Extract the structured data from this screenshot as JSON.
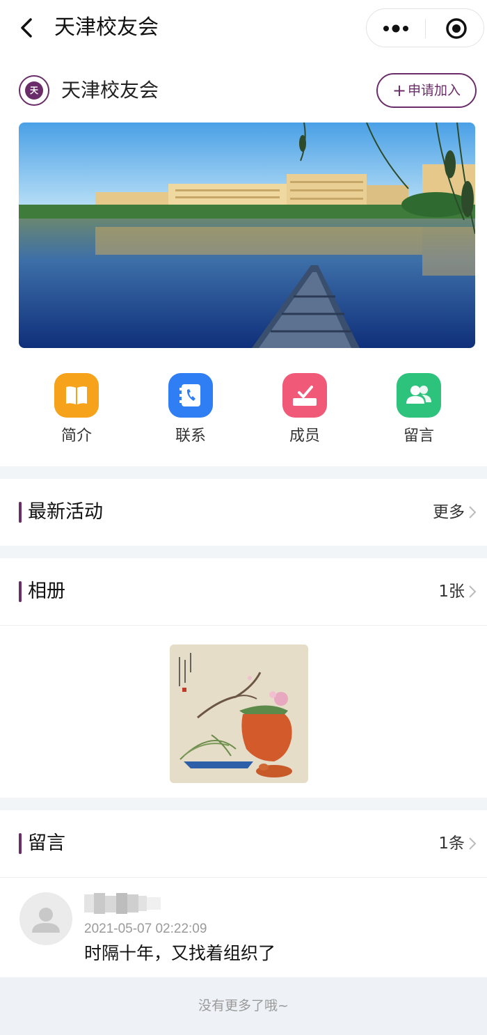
{
  "navbar": {
    "title": "天津校友会",
    "back_icon": "chevron-left-icon",
    "capsule": {
      "more_icon": "more-dots-icon",
      "close_icon": "target-circle-icon"
    }
  },
  "header": {
    "logo_text": "天",
    "group_name": "天津校友会",
    "join_button": {
      "icon": "+",
      "label": "申请加入"
    }
  },
  "shortcuts": [
    {
      "label": "简介",
      "icon": "book-icon",
      "color": "#f6a21a"
    },
    {
      "label": "联系",
      "icon": "phone-book-icon",
      "color": "#2f7ef3"
    },
    {
      "label": "成员",
      "icon": "ballot-check-icon",
      "color": "#f05a78"
    },
    {
      "label": "留言",
      "icon": "people-icon",
      "color": "#2ec37c"
    }
  ],
  "sections": {
    "activities": {
      "title": "最新活动",
      "more": "更多"
    },
    "album": {
      "title": "相册",
      "more": "1张"
    },
    "messages": {
      "title": "留言",
      "more": "1条"
    }
  },
  "message": {
    "time": "2021-05-07 02:22:09",
    "text": "时隔十年，又找着组织了"
  },
  "footer": {
    "text": "没有更多了哦~"
  },
  "colors": {
    "accent": "#6b2c6a",
    "background": "#f2f5f8"
  }
}
